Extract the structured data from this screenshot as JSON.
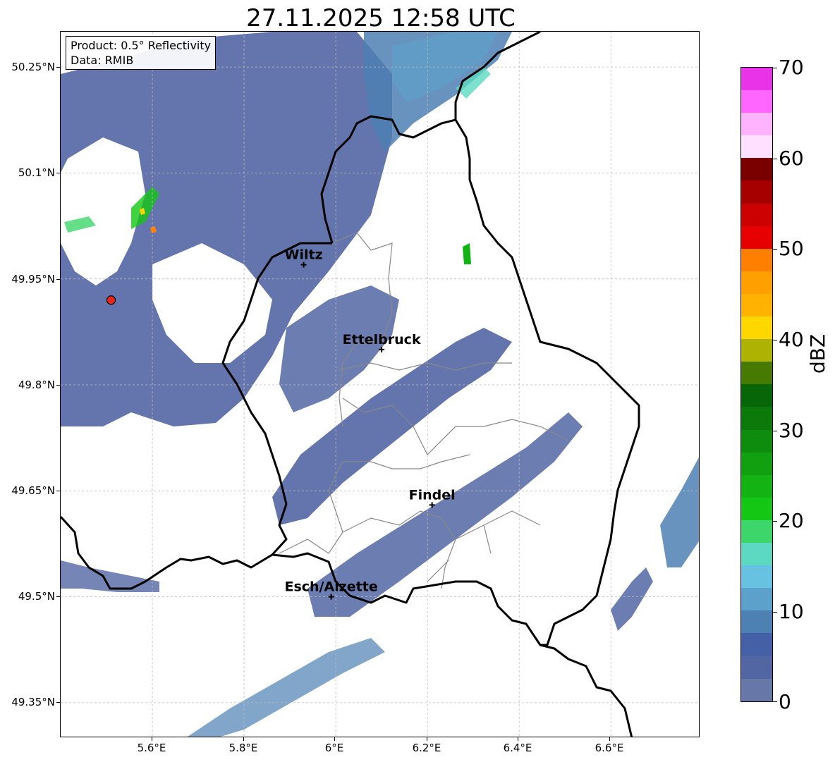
{
  "title": "27.11.2025 12:58 UTC",
  "info": {
    "product": "Product: 0.5° Reflectivity",
    "source": "Data: RMIB"
  },
  "lat_labels": [
    "50.25°N",
    "50.1°N",
    "49.95°N",
    "49.8°N",
    "49.65°N",
    "49.5°N",
    "49.35°N"
  ],
  "lon_labels": [
    "5.6°E",
    "5.8°E",
    "6°E",
    "6.2°E",
    "6.4°E",
    "6.6°E"
  ],
  "cities": [
    {
      "name": "Wiltz",
      "lon": 5.93,
      "lat": 49.97
    },
    {
      "name": "Ettelbruck",
      "lon": 6.1,
      "lat": 49.85
    },
    {
      "name": "Findel",
      "lon": 6.21,
      "lat": 49.63
    },
    {
      "name": "Esch/Alzette",
      "lon": 5.99,
      "lat": 49.5
    }
  ],
  "radar_site": {
    "lon": 5.51,
    "lat": 49.92,
    "color": "#e8261b"
  },
  "extent": {
    "lon_min": 5.4,
    "lon_max": 6.795,
    "lat_min": 49.3,
    "lat_max": 50.3
  },
  "colorbar": {
    "label": "dBZ",
    "ticks": [
      "70",
      "60",
      "50",
      "40",
      "30",
      "20",
      "10",
      "0"
    ],
    "range": [
      0,
      70
    ],
    "colors_top_to_bottom": [
      "#e833e8",
      "#ff66ff",
      "#ffb3ff",
      "#ffe0ff",
      "#7a0000",
      "#a60000",
      "#cc0000",
      "#e60000",
      "#ff7f00",
      "#ff9f00",
      "#ffb300",
      "#ffd700",
      "#adb300",
      "#467a00",
      "#076607",
      "#0b7a0b",
      "#0d8c0d",
      "#10a010",
      "#12b312",
      "#14c714",
      "#3dd66b",
      "#5cd9c1",
      "#66c2e0",
      "#5ba1cc",
      "#4d80b3",
      "#4460a6",
      "#5266a3",
      "#6677a8"
    ]
  },
  "colors": {
    "border": "#000000",
    "canton": "#888888",
    "grid": "#bbbbbb"
  }
}
